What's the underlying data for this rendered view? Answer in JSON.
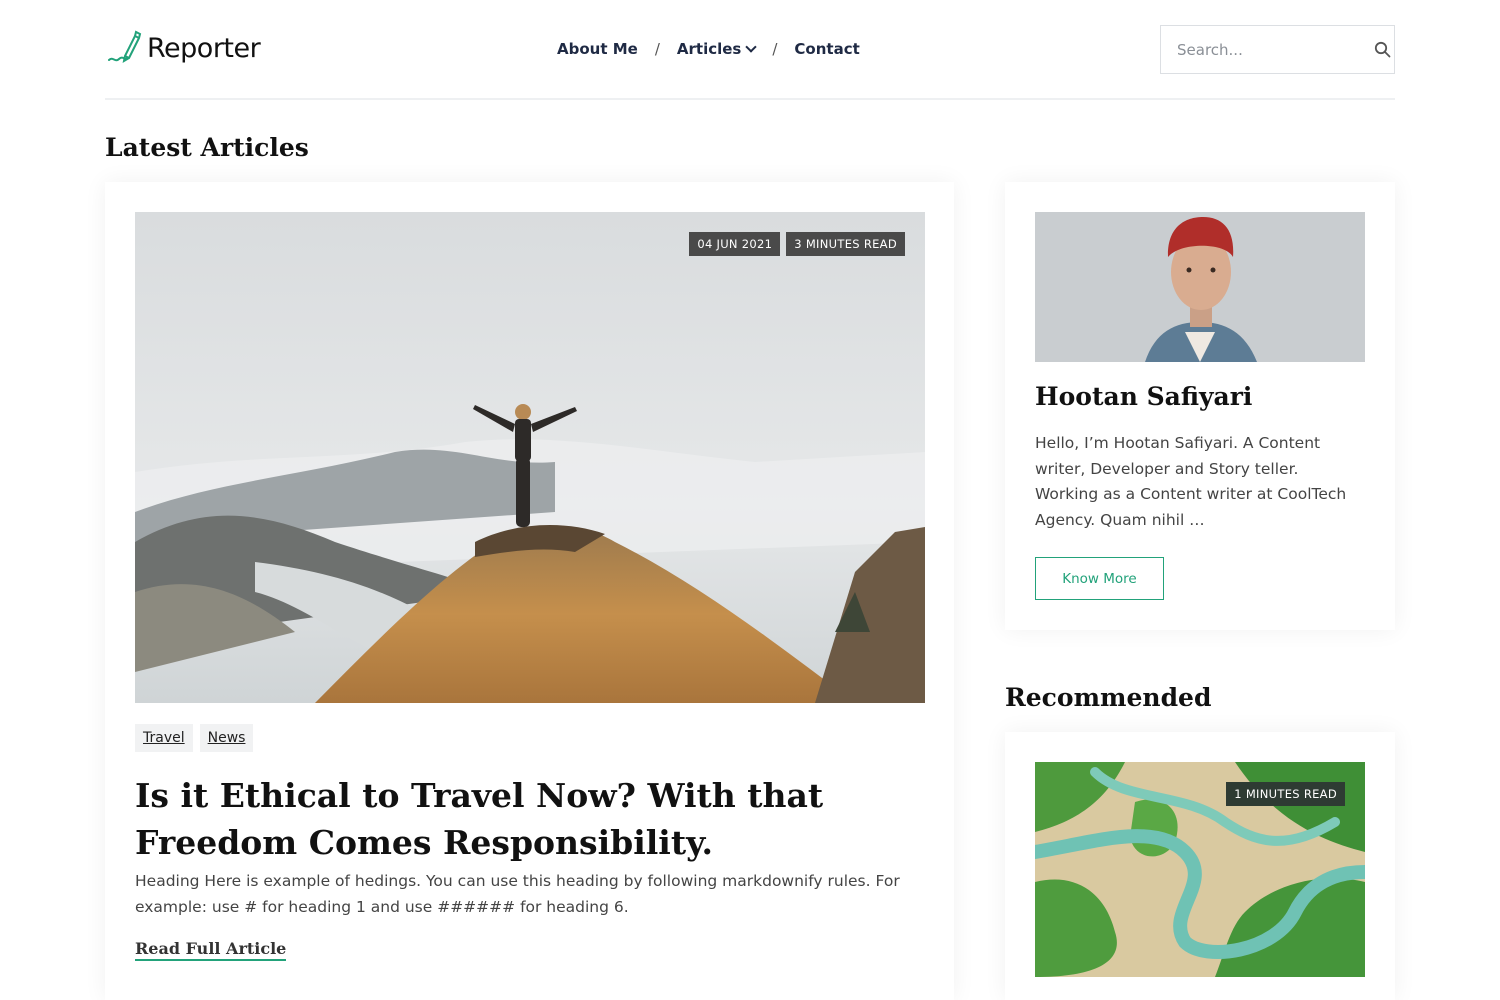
{
  "header": {
    "logo_text": "Reporter",
    "nav": [
      {
        "label": "About Me"
      },
      {
        "label": "Articles"
      },
      {
        "label": "Contact"
      }
    ],
    "nav_separator": "/",
    "search_placeholder": "Search..."
  },
  "latest": {
    "title": "Latest Articles",
    "article": {
      "date": "04 JUN 2021",
      "read_time": "3 MINUTES READ",
      "tags": [
        "Travel",
        "News"
      ],
      "title": "Is it Ethical to Travel Now? With that Freedom Comes Responsibility.",
      "excerpt": "Heading Here is example of hedings. You can use this heading by following markdownify rules. For example: use # for heading 1 and use ###### for heading 6.",
      "read_more": "Read Full Article"
    }
  },
  "author": {
    "name": "Hootan Safiyari",
    "bio": "Hello, I’m Hootan Safiyari. A Content writer, Developer and Story teller. Working as a Content writer at CoolTech Agency. Quam nihil …",
    "button": "Know More"
  },
  "recommended": {
    "title": "Recommended",
    "item": {
      "read_time": "1 MINUTES READ"
    }
  },
  "colors": {
    "accent": "#22a27a",
    "nav_text": "#1f2a44",
    "badge_bg": "#4a4a4a"
  }
}
